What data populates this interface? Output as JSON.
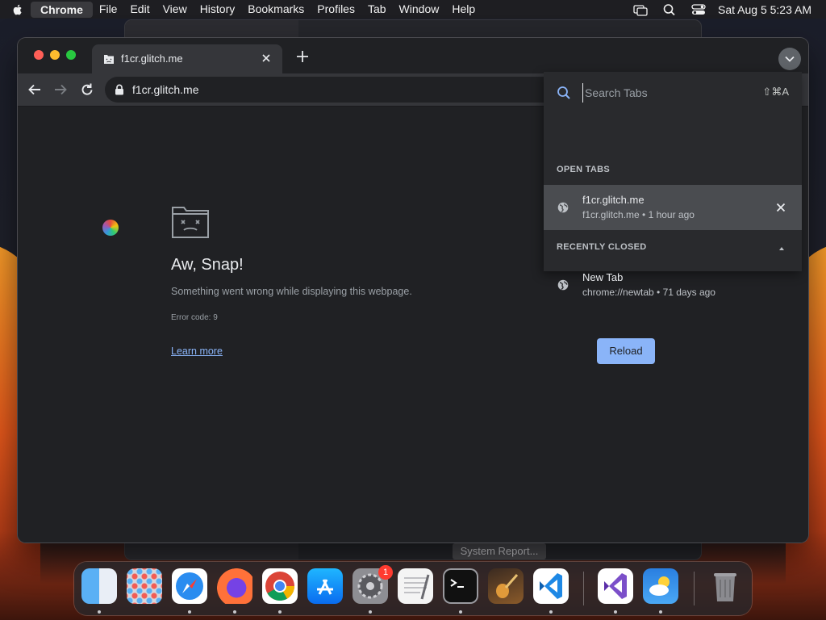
{
  "menubar": {
    "app_name": "Chrome",
    "items": [
      "File",
      "Edit",
      "View",
      "History",
      "Bookmarks",
      "Profiles",
      "Tab",
      "Window",
      "Help"
    ],
    "clock": "Sat Aug 5  5:23 AM"
  },
  "browser": {
    "tab_title": "f1cr.glitch.me",
    "url": "f1cr.glitch.me"
  },
  "error_page": {
    "title": "Aw, Snap!",
    "message": "Something went wrong while displaying this webpage.",
    "error_code": "Error code: 9",
    "learn_more": "Learn more",
    "reload": "Reload"
  },
  "tab_search": {
    "placeholder": "Search Tabs",
    "shortcut": "⇧⌘A",
    "open_tabs_label": "OPEN TABS",
    "open_tabs": [
      {
        "title": "f1cr.glitch.me",
        "subtitle": "f1cr.glitch.me • 1 hour ago"
      }
    ],
    "recently_closed_label": "RECENTLY CLOSED",
    "recently_closed": [
      {
        "title": "New Tab",
        "subtitle": "chrome://newtab • 71 days ago"
      }
    ]
  },
  "background": {
    "system_report_button": "System Report..."
  },
  "dock": {
    "apps": [
      "Finder",
      "Launchpad",
      "Safari",
      "Firefox",
      "Google Chrome",
      "App Store",
      "System Settings",
      "TextEdit",
      "Terminal",
      "GarageBand",
      "Visual Studio Code",
      "Visual Studio",
      "Weather",
      "Trash"
    ],
    "settings_badge": "1"
  }
}
